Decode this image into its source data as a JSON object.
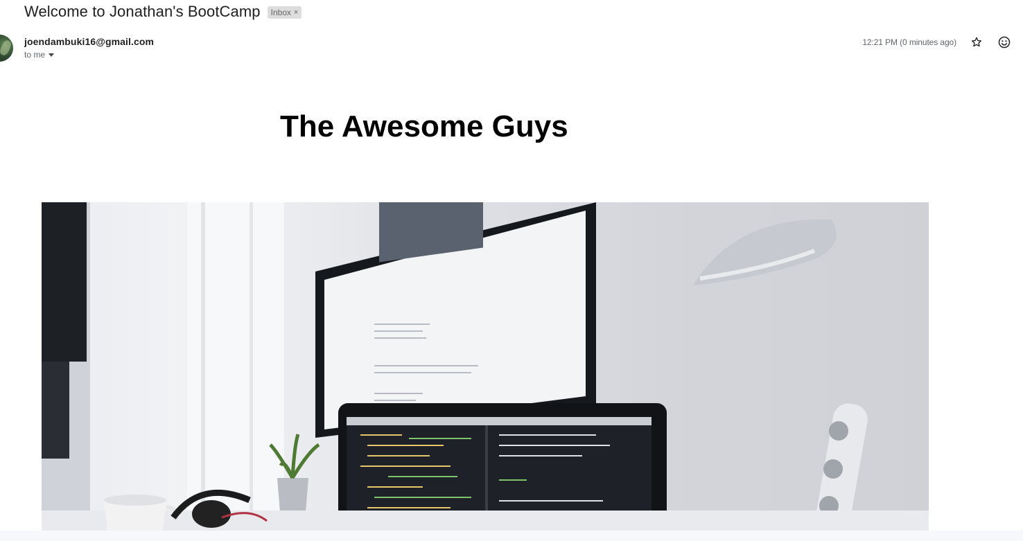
{
  "email": {
    "subject": "Welcome to Jonathan's BootCamp",
    "label": "Inbox",
    "label_remove": "×",
    "sender": "joendambuki16@gmail.com",
    "recipient_text": "to me",
    "timestamp": "12:21 PM (0 minutes ago)"
  },
  "icons": {
    "star": "star-icon",
    "emoji": "emoji-reaction-icon",
    "caret": "chevron-down-icon"
  },
  "body": {
    "heading": "The Awesome Guys",
    "image_alt": "workspace-photo"
  },
  "colors": {
    "subject": "#1f1f1f",
    "label_bg": "#dddddd",
    "muted": "#5f6368",
    "heading": "#000000"
  }
}
